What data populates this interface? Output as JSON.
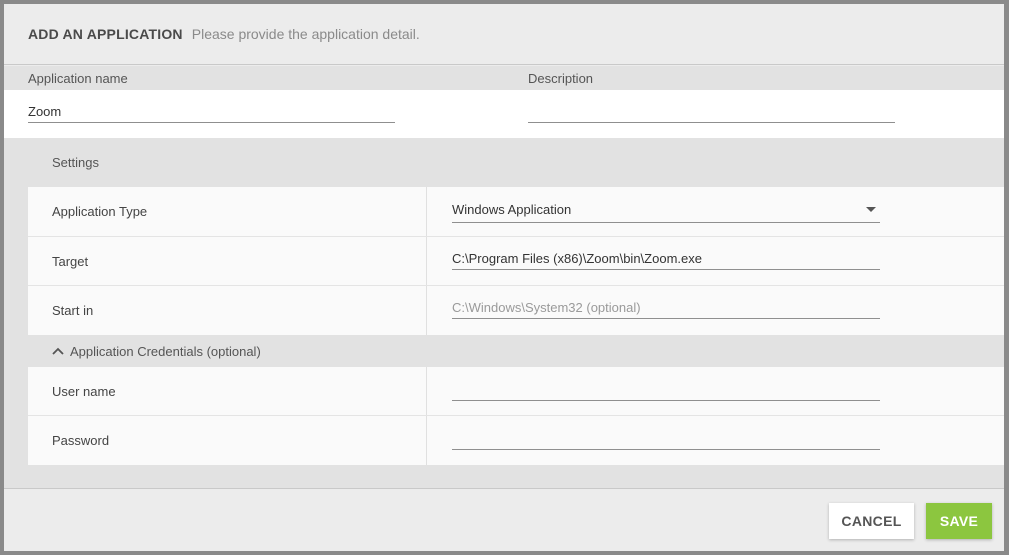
{
  "header": {
    "title": "ADD AN APPLICATION",
    "subtitle": "Please provide the application detail."
  },
  "top_fields": {
    "name_label": "Application name",
    "name_value": "Zoom",
    "description_label": "Description",
    "description_value": ""
  },
  "settings": {
    "section_title": "Settings",
    "app_type_label": "Application Type",
    "app_type_value": "Windows Application",
    "target_label": "Target",
    "target_value": "C:\\Program Files (x86)\\Zoom\\bin\\Zoom.exe",
    "start_in_label": "Start in",
    "start_in_value": "",
    "start_in_placeholder": "C:\\Windows\\System32 (optional)"
  },
  "credentials": {
    "section_title": "Application Credentials (optional)",
    "expanded": true,
    "username_label": "User name",
    "username_value": "",
    "password_label": "Password",
    "password_value": ""
  },
  "footer": {
    "cancel_label": "CANCEL",
    "save_label": "SAVE"
  },
  "colors": {
    "save_button": "#8cc63f",
    "background": "#ececec",
    "section_band": "#e2e2e2"
  },
  "icons": {
    "dropdown": "triangle-down-icon",
    "collapse": "chevron-up-icon"
  }
}
